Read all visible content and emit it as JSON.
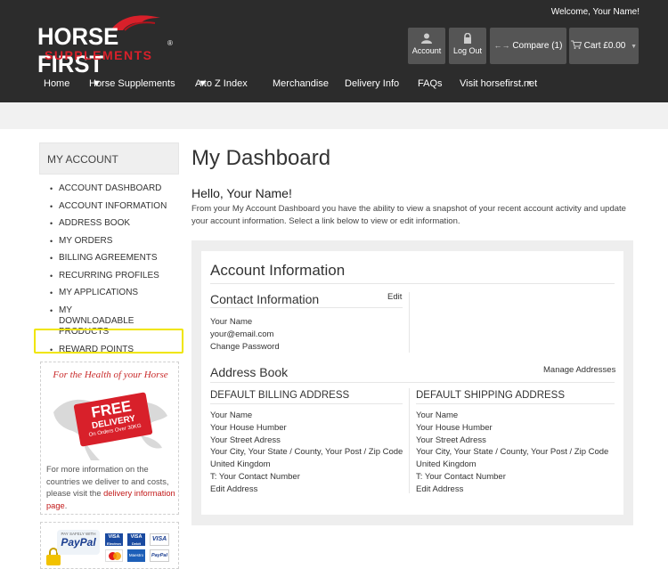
{
  "header": {
    "welcome": "Welcome, Your Name!",
    "logo_word": "HORSE FIRST",
    "logo_sub": "SUPPLEMENTS",
    "logo_reg": "®",
    "account_label": "Account",
    "logout_label": "Log Out",
    "compare_label": "Compare (1)",
    "cart_label": "Cart £0.00"
  },
  "nav": {
    "home": "Home",
    "supplements": "Horse Supplements",
    "atoz": "A to Z Index",
    "merch": "Merchandise",
    "delivery": "Delivery Info",
    "faqs": "FAQs",
    "visit": "Visit horsefirst.net"
  },
  "sidebar": {
    "heading": "MY ACCOUNT",
    "items": [
      "ACCOUNT DASHBOARD",
      "ACCOUNT INFORMATION",
      "ADDRESS BOOK",
      "MY ORDERS",
      "BILLING AGREEMENTS",
      "RECURRING PROFILES",
      "MY APPLICATIONS",
      "MY DOWNLOADABLE PRODUCTS",
      "REWARD POINTS"
    ],
    "promo": {
      "title": "For the Health of your Horse",
      "tag_free": "FREE",
      "tag_delivery": "DELIVERY",
      "tag_note": "On Orders Over 30KG",
      "text_before": "For more information on the countries we deliver to and costs, please visit the ",
      "link": "delivery information page",
      "text_after": "."
    },
    "payments": {
      "paid_safely": "PAY SAFELY WITH",
      "paypal": "PayPal",
      "card1": "VISA",
      "card1_sub": "Electron",
      "card2": "VISA",
      "card2_sub": "Debit",
      "card3": "VISA",
      "card4": "Maestro",
      "card5": "PayPal"
    }
  },
  "main": {
    "title": "My Dashboard",
    "hello": "Hello, Your Name!",
    "intro": "From your My Account Dashboard you have the ability to view a snapshot of your recent account activity and update your account information. Select a link below to view or edit information.",
    "account_info_heading": "Account Information",
    "contact_heading": "Contact Information",
    "contact_edit": "Edit",
    "contact_lines": [
      "Your Name",
      "your@email.com",
      "Change Password"
    ],
    "address_book_heading": "Address Book",
    "manage_addresses": "Manage Addresses",
    "billing_heading": "DEFAULT BILLING ADDRESS",
    "shipping_heading": "DEFAULT SHIPPING ADDRESS",
    "billing_lines": [
      "Your Name",
      "Your House Humber",
      "Your Street Adress",
      "Your City, Your State / County, Your Post / Zip Code",
      "United Kingdom",
      "T: Your Contact Number",
      "Edit Address"
    ],
    "shipping_lines": [
      "Your Name",
      "Your House Humber",
      "Your Street Adress",
      "Your City, Your State / County, Your Post / Zip Code",
      "United Kingdom",
      "T: Your Contact Number",
      "Edit Address"
    ]
  },
  "colors": {
    "header_bg": "#2c2c2c",
    "brand_red": "#d8202a",
    "highlight": "#f0e500"
  }
}
